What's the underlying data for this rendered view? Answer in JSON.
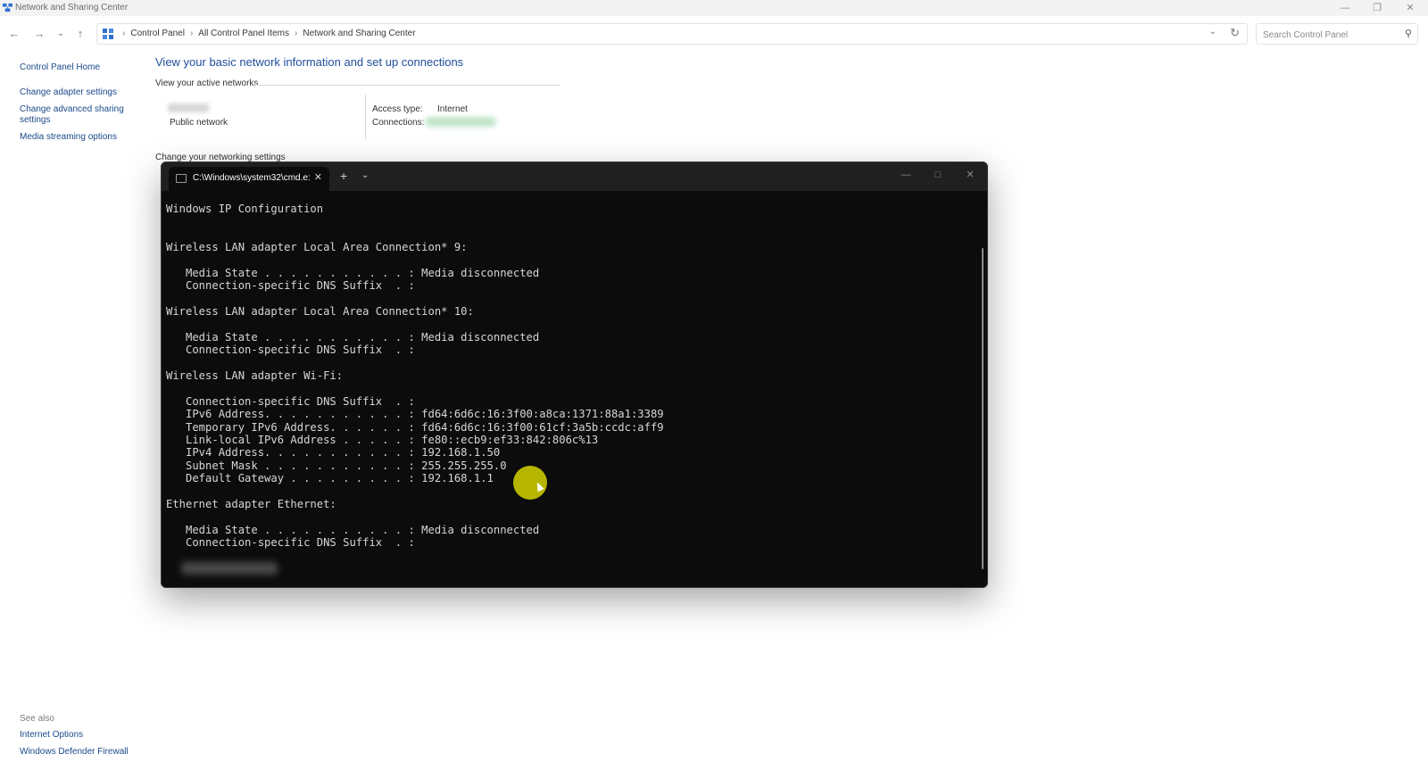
{
  "window": {
    "title": "Network and Sharing Center"
  },
  "navigation": {
    "breadcrumbs": [
      "Control Panel",
      "All Control Panel Items",
      "Network and Sharing Center"
    ],
    "search_placeholder": "Search Control Panel"
  },
  "sidebar": {
    "items": [
      "Control Panel Home",
      "Change adapter settings",
      "Change advanced sharing settings",
      "Media streaming options"
    ]
  },
  "main": {
    "title": "View your basic network information and set up connections",
    "active_networks_label": "View your active networks",
    "network_type": "Public network",
    "access_type_label": "Access type:",
    "access_type_value": "Internet",
    "connections_label": "Connections:",
    "change_settings_label": "Change your networking settings"
  },
  "see_also": {
    "header": "See also",
    "items": [
      "Internet Options",
      "Windows Defender Firewall"
    ]
  },
  "terminal": {
    "tab_title": "C:\\Windows\\system32\\cmd.e:",
    "lines": [
      "Windows IP Configuration",
      "",
      "",
      "Wireless LAN adapter Local Area Connection* 9:",
      "",
      "   Media State . . . . . . . . . . . : Media disconnected",
      "   Connection-specific DNS Suffix  . :",
      "",
      "Wireless LAN adapter Local Area Connection* 10:",
      "",
      "   Media State . . . . . . . . . . . : Media disconnected",
      "   Connection-specific DNS Suffix  . :",
      "",
      "Wireless LAN adapter Wi-Fi:",
      "",
      "   Connection-specific DNS Suffix  . :",
      "   IPv6 Address. . . . . . . . . . . : fd64:6d6c:16:3f00:a8ca:1371:88a1:3389",
      "   Temporary IPv6 Address. . . . . . : fd64:6d6c:16:3f00:61cf:3a5b:ccdc:aff9",
      "   Link-local IPv6 Address . . . . . : fe80::ecb9:ef33:842:806c%13",
      "   IPv4 Address. . . . . . . . . . . : 192.168.1.50",
      "   Subnet Mask . . . . . . . . . . . : 255.255.255.0",
      "   Default Gateway . . . . . . . . . : 192.168.1.1",
      "",
      "Ethernet adapter Ethernet:",
      "",
      "   Media State . . . . . . . . . . . : Media disconnected",
      "   Connection-specific DNS Suffix  . :"
    ]
  },
  "colors": {
    "link": "#1a4a8a",
    "title_blue": "#1f4e9a",
    "terminal_bg": "#0c0c0c",
    "cursor_highlight": "#c6c600"
  }
}
